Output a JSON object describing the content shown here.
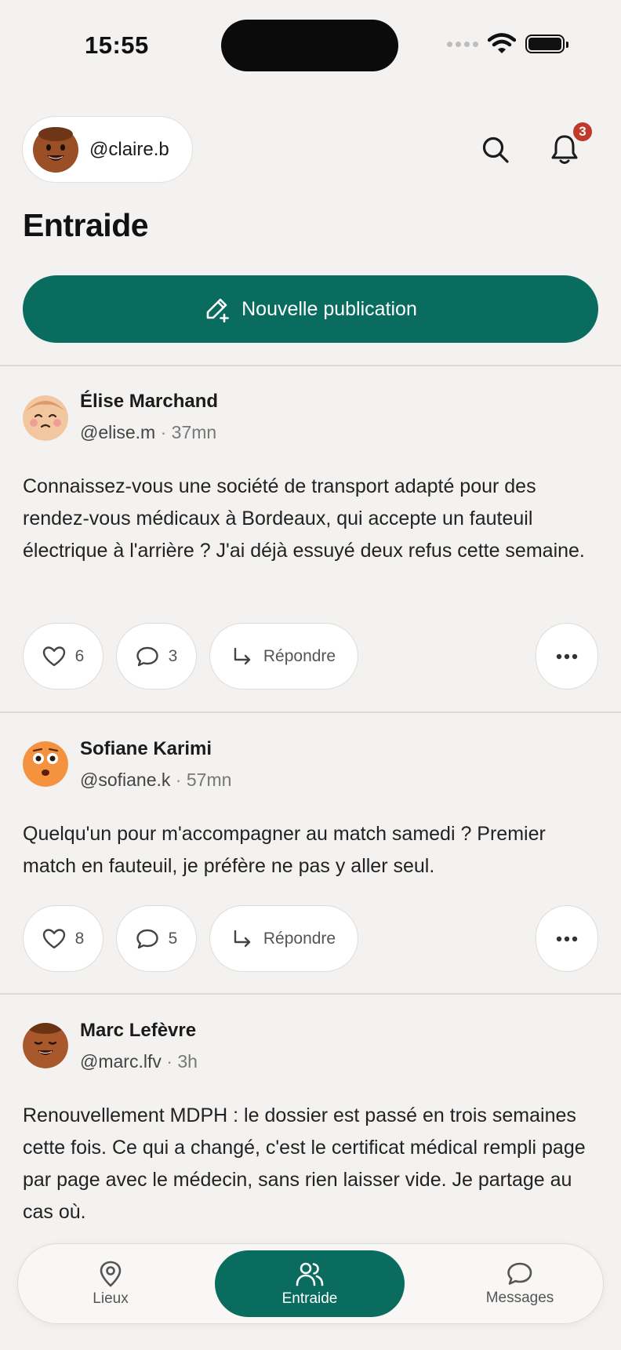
{
  "status_bar": {
    "time": "15:55"
  },
  "header": {
    "username": "@claire.b",
    "notification_count": "3",
    "title": "Entraide",
    "new_post_label": "Nouvelle publication"
  },
  "posts": [
    {
      "author": "Élise Marchand",
      "handle": "@elise.m",
      "separator": "·",
      "time": "37mn",
      "text": "Connaissez-vous une société de transport adapté pour des rendez-vous médicaux à Bordeaux, qui accepte un fauteuil électrique à l'arrière ? J'ai déjà essuyé deux refus cette semaine.",
      "likes": "6",
      "comments": "3",
      "reply_label": "Répondre"
    },
    {
      "author": "Sofiane Karimi",
      "handle": "@sofiane.k",
      "separator": "·",
      "time": "57mn",
      "text": "Quelqu'un pour m'accompagner au match samedi ? Premier match en fauteuil, je préfère ne pas y aller seul.",
      "likes": "8",
      "comments": "5",
      "reply_label": "Répondre"
    },
    {
      "author": "Marc Lefèvre",
      "handle": "@marc.lfv",
      "separator": "·",
      "time": "3h",
      "text": "Renouvellement MDPH : le dossier est passé en trois semaines cette fois. Ce qui a changé, c'est le certificat médical rempli page par page avec le médecin, sans rien laisser vide. Je partage au cas où."
    }
  ],
  "tabs": [
    {
      "label": "Lieux",
      "icon": "map-pin-icon"
    },
    {
      "label": "Entraide",
      "icon": "users-icon",
      "active": true
    },
    {
      "label": "Messages",
      "icon": "chat-bubble-icon"
    }
  ],
  "colors": {
    "accent": "#0a6b5f",
    "badge": "#c0392b",
    "background": "#f3f2f0"
  }
}
